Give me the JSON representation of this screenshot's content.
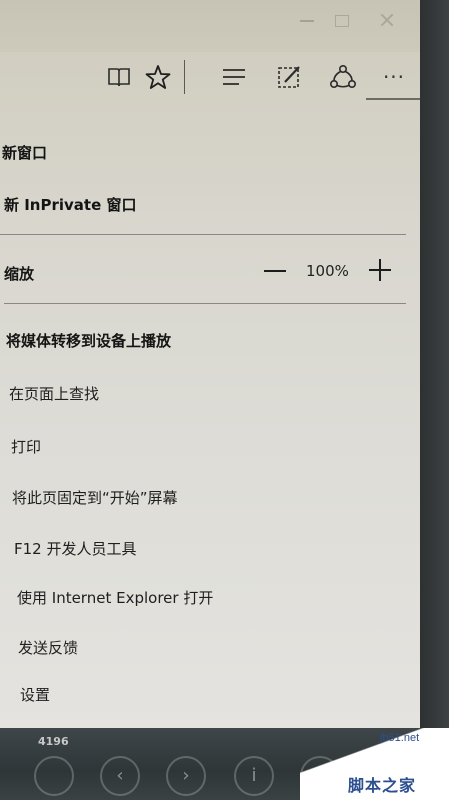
{
  "toolbar": {
    "icons": [
      "reading-view-icon",
      "favorite-star-icon",
      "hub-icon",
      "web-note-icon",
      "share-icon",
      "more-icon"
    ],
    "more_label": "···"
  },
  "menu": {
    "new_window": "新窗口",
    "new_inprivate": "新 InPrivate 窗口",
    "zoom": {
      "label": "缩放",
      "value": "100%"
    },
    "cast_media": "将媒体转移到设备上播放",
    "find_on_page": "在页面上查找",
    "print": "打印",
    "pin_to_start": "将此页固定到“开始”屏幕",
    "f12_tools": "F12 开发人员工具",
    "open_with_ie": "使用 Internet Explorer 打开",
    "send_feedback": "发送反馈",
    "settings": "设置"
  },
  "taskbar": {
    "number": "4196"
  },
  "watermark": {
    "url": "jb51.net",
    "name": "脚本之家"
  },
  "colors": {
    "menu_bg": "#dddcd6",
    "text": "#1f1f1f",
    "divider": "#8a8880",
    "watermark_blue": "#2c4f8f"
  }
}
